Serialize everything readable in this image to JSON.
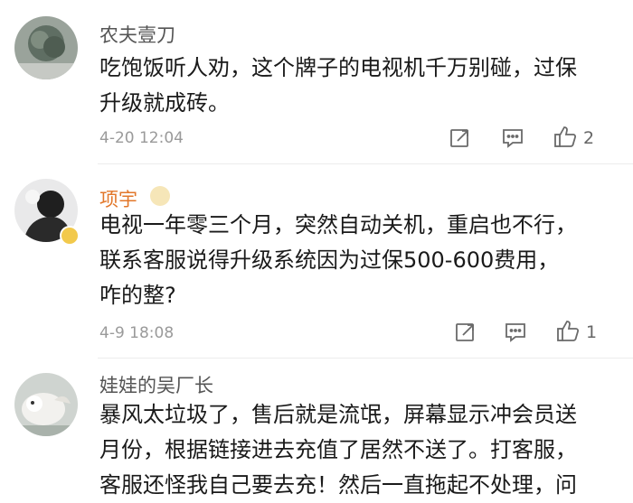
{
  "comments": [
    {
      "user": "农夫壹刀",
      "lines": [
        "吃饱饭听人劝，这个牌子的电视机千万别碰，过保",
        "升级就成砖。"
      ],
      "time": "4-20 12:04",
      "likes": "2"
    },
    {
      "user": "项宇",
      "lines": [
        "电视一年零三个月，突然自动关机，重启也不行，",
        "联系客服说得升级系统因为过保500-600费用，",
        "咋的整?"
      ],
      "time": "4-9 18:08",
      "likes": "1"
    },
    {
      "user": "娃娃的吴厂长",
      "lines": [
        "暴风太垃圾了，售后就是流氓，屏幕显示冲会员送",
        "月份，根据链接进去充值了居然不送了。打客服，",
        "客服还怪我自己要去充！然后一直拖起不处理，问"
      ],
      "time": "",
      "likes": ""
    }
  ],
  "icons": {
    "share": "share-icon",
    "comment": "comment-icon",
    "like": "thumbs-up-icon",
    "vip": "vip-badge-icon",
    "verified": "verified-badge-icon"
  },
  "colors": {
    "username": "#555555",
    "username_vip": "#e2772a",
    "text": "#1a1a1a",
    "meta": "#9a9a9a"
  }
}
